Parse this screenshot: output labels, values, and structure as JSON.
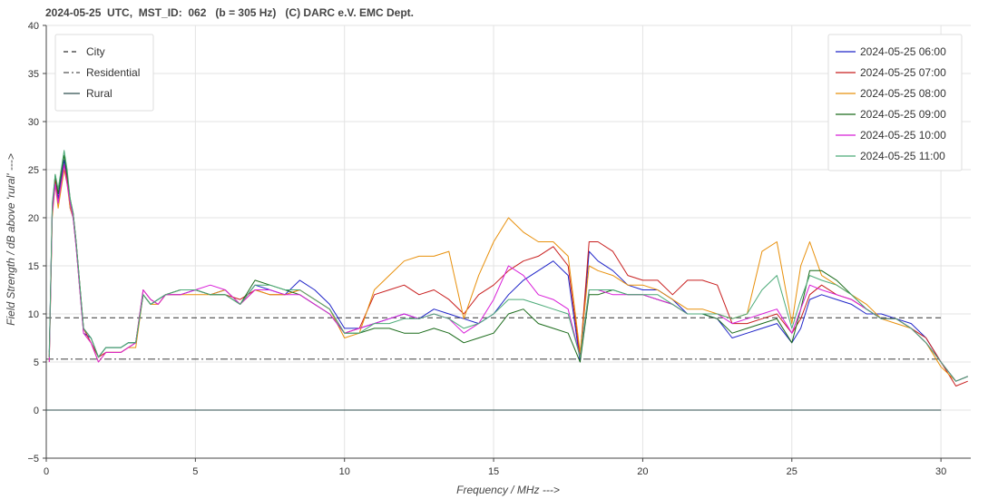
{
  "chart_data": {
    "type": "line",
    "title": "2024-05-25  UTC,  MST_ID:  062   (b = 305 Hz)   (C) DARC e.V. EMC Dept.",
    "xlabel": "Frequency / MHz --->",
    "ylabel": "Field Strength / dB above 'rural' --->",
    "xlim": [
      0,
      31
    ],
    "ylim": [
      -5,
      40
    ],
    "xticks": [
      0,
      5,
      10,
      15,
      20,
      25,
      30
    ],
    "yticks": [
      -5,
      0,
      5,
      10,
      15,
      20,
      25,
      30,
      35,
      40
    ],
    "grid": true,
    "reference_legend_position": "top-left",
    "series_legend_position": "top-right",
    "reference_lines": [
      {
        "name": "City",
        "y": 9.6,
        "x_range": [
          0,
          30
        ],
        "style": "dashed",
        "color": "#333333"
      },
      {
        "name": "Residential",
        "y": 5.3,
        "x_range": [
          0,
          30
        ],
        "style": "dashdot",
        "color": "#555555"
      },
      {
        "name": "Rural",
        "y": 0,
        "x_range": [
          0,
          30
        ],
        "style": "solid",
        "color": "#2f4f4f"
      }
    ],
    "x": [
      0.1,
      0.2,
      0.3,
      0.4,
      0.5,
      0.6,
      0.7,
      0.8,
      0.9,
      1.0,
      1.25,
      1.5,
      1.75,
      2.0,
      2.25,
      2.5,
      2.75,
      3.0,
      3.25,
      3.5,
      3.75,
      4.0,
      4.5,
      5.0,
      5.5,
      6.0,
      6.5,
      7.0,
      7.5,
      8.0,
      8.5,
      9.0,
      9.5,
      10.0,
      10.5,
      11.0,
      11.5,
      12.0,
      12.5,
      13.0,
      13.5,
      14.0,
      14.5,
      15.0,
      15.5,
      16.0,
      16.5,
      17.0,
      17.5,
      17.9,
      18.2,
      18.5,
      19.0,
      19.5,
      20.0,
      20.5,
      21.0,
      21.5,
      22.0,
      22.5,
      23.0,
      23.5,
      24.0,
      24.5,
      25.0,
      25.3,
      25.6,
      26.0,
      26.5,
      27.0,
      27.5,
      28.0,
      28.5,
      29.0,
      29.5,
      30.0,
      30.5,
      30.9
    ],
    "series": [
      {
        "name": "2024-05-25 06:00",
        "color": "#1f24c8",
        "values": [
          6.0,
          21.0,
          24.0,
          22.0,
          24.0,
          26.0,
          24.0,
          21.0,
          20.0,
          17.0,
          8.0,
          7.5,
          5.5,
          6.5,
          6.5,
          6.5,
          7.0,
          7.0,
          12.0,
          11.0,
          11.5,
          12.0,
          12.0,
          12.5,
          12.0,
          12.5,
          11.0,
          13.0,
          12.5,
          12.0,
          13.5,
          12.5,
          11.0,
          8.5,
          8.5,
          9.0,
          9.5,
          10.0,
          9.5,
          10.5,
          10.0,
          9.5,
          9.0,
          10.0,
          12.0,
          13.5,
          14.5,
          15.5,
          14.0,
          5.0,
          16.5,
          15.5,
          14.5,
          13.0,
          12.5,
          12.5,
          11.5,
          10.0,
          10.0,
          9.5,
          7.5,
          8.0,
          8.5,
          9.0,
          7.0,
          8.5,
          11.5,
          12.0,
          11.5,
          11.0,
          10.0,
          10.0,
          9.5,
          9.0,
          7.5,
          5.0,
          3.0,
          3.5
        ]
      },
      {
        "name": "2024-05-25 07:00",
        "color": "#c81e1e",
        "values": [
          5.5,
          20.5,
          24.0,
          21.5,
          23.5,
          25.5,
          24.0,
          21.5,
          20.5,
          17.5,
          8.5,
          7.0,
          5.5,
          6.0,
          6.0,
          6.0,
          6.5,
          7.0,
          12.5,
          11.5,
          11.0,
          12.0,
          12.5,
          12.5,
          12.0,
          12.0,
          11.5,
          12.5,
          12.0,
          12.0,
          12.5,
          11.5,
          10.5,
          8.0,
          8.5,
          12.0,
          12.5,
          13.0,
          12.0,
          12.5,
          11.5,
          10.0,
          12.0,
          13.0,
          14.5,
          15.5,
          16.0,
          17.0,
          15.0,
          5.5,
          17.5,
          17.5,
          16.5,
          14.0,
          13.5,
          13.5,
          12.0,
          13.5,
          13.5,
          13.0,
          9.0,
          9.0,
          9.5,
          10.0,
          8.0,
          9.5,
          12.0,
          13.0,
          12.0,
          11.5,
          10.5,
          9.5,
          9.5,
          8.5,
          7.5,
          5.0,
          2.5,
          3.0
        ]
      },
      {
        "name": "2024-05-25 08:00",
        "color": "#e8900c",
        "values": [
          5.0,
          20.0,
          23.5,
          21.0,
          23.0,
          25.0,
          23.5,
          21.0,
          20.0,
          17.0,
          8.0,
          7.0,
          5.0,
          6.0,
          6.0,
          6.0,
          6.5,
          6.5,
          12.0,
          11.0,
          11.0,
          12.0,
          12.0,
          12.0,
          12.0,
          12.5,
          11.0,
          12.5,
          12.0,
          12.0,
          12.5,
          11.5,
          10.5,
          7.5,
          8.0,
          12.5,
          14.0,
          15.5,
          16.0,
          16.0,
          16.5,
          9.5,
          14.0,
          17.5,
          20.0,
          18.5,
          17.5,
          17.5,
          16.0,
          6.0,
          15.0,
          14.5,
          14.0,
          13.0,
          13.0,
          12.5,
          11.5,
          10.5,
          10.5,
          10.0,
          9.5,
          10.0,
          16.5,
          17.5,
          9.0,
          15.0,
          17.5,
          14.0,
          13.0,
          12.0,
          11.0,
          9.5,
          9.0,
          8.5,
          7.0,
          4.5,
          3.0,
          3.5
        ]
      },
      {
        "name": "2024-05-25 09:00",
        "color": "#1a6b1a",
        "values": [
          5.5,
          21.0,
          24.5,
          22.5,
          24.5,
          26.5,
          24.5,
          22.0,
          20.5,
          17.5,
          8.5,
          7.5,
          5.5,
          6.5,
          6.5,
          6.5,
          7.0,
          7.0,
          12.0,
          11.0,
          11.5,
          12.0,
          12.5,
          12.5,
          12.0,
          12.0,
          11.0,
          13.5,
          13.0,
          12.5,
          12.0,
          11.0,
          10.0,
          8.0,
          8.0,
          8.5,
          8.5,
          8.0,
          8.0,
          8.5,
          8.0,
          7.0,
          7.5,
          8.0,
          10.0,
          10.5,
          9.0,
          8.5,
          8.0,
          5.0,
          12.0,
          12.0,
          12.5,
          12.0,
          12.0,
          11.5,
          11.0,
          10.0,
          10.0,
          9.5,
          8.0,
          8.5,
          9.0,
          9.5,
          7.0,
          10.5,
          14.5,
          14.5,
          13.5,
          12.0,
          10.5,
          9.5,
          9.5,
          8.5,
          7.0,
          5.0,
          3.0,
          3.5
        ]
      },
      {
        "name": "2024-05-25 10:00",
        "color": "#d81ed8",
        "values": [
          5.0,
          20.5,
          23.5,
          21.5,
          23.5,
          25.5,
          23.5,
          21.5,
          20.0,
          17.0,
          8.0,
          7.0,
          5.0,
          6.0,
          6.0,
          6.0,
          6.5,
          7.0,
          12.5,
          11.5,
          11.0,
          12.0,
          12.0,
          12.5,
          13.0,
          12.5,
          11.0,
          12.5,
          12.5,
          12.0,
          12.0,
          11.0,
          10.0,
          8.0,
          8.5,
          9.0,
          9.5,
          10.0,
          9.5,
          10.0,
          9.5,
          8.0,
          9.0,
          11.5,
          15.0,
          14.0,
          12.0,
          11.5,
          10.5,
          5.5,
          12.5,
          12.5,
          12.0,
          12.0,
          12.0,
          11.5,
          11.0,
          10.0,
          10.0,
          10.0,
          9.0,
          9.5,
          10.0,
          10.5,
          8.0,
          10.5,
          13.0,
          12.5,
          12.0,
          11.5,
          10.5,
          9.5,
          9.5,
          8.5,
          7.0,
          5.0,
          3.0,
          3.5
        ]
      },
      {
        "name": "2024-05-25 11:00",
        "color": "#4caa78",
        "values": [
          5.5,
          21.5,
          24.5,
          23.0,
          25.0,
          27.0,
          25.0,
          22.0,
          20.5,
          17.5,
          8.5,
          7.5,
          5.5,
          6.5,
          6.5,
          6.5,
          7.0,
          7.0,
          12.0,
          11.0,
          11.5,
          12.0,
          12.5,
          12.5,
          12.0,
          12.0,
          11.0,
          13.0,
          13.0,
          12.5,
          12.5,
          11.5,
          10.5,
          8.0,
          8.0,
          9.0,
          9.0,
          9.5,
          9.5,
          10.0,
          9.5,
          8.5,
          9.0,
          10.0,
          11.5,
          11.5,
          11.0,
          10.5,
          10.0,
          5.5,
          12.5,
          12.5,
          12.5,
          12.0,
          12.0,
          12.0,
          11.0,
          10.0,
          10.0,
          10.0,
          9.5,
          10.0,
          12.5,
          14.0,
          8.5,
          11.5,
          14.0,
          13.5,
          13.0,
          12.0,
          10.5,
          9.5,
          9.5,
          8.5,
          7.0,
          5.0,
          3.0,
          3.5
        ]
      }
    ]
  }
}
